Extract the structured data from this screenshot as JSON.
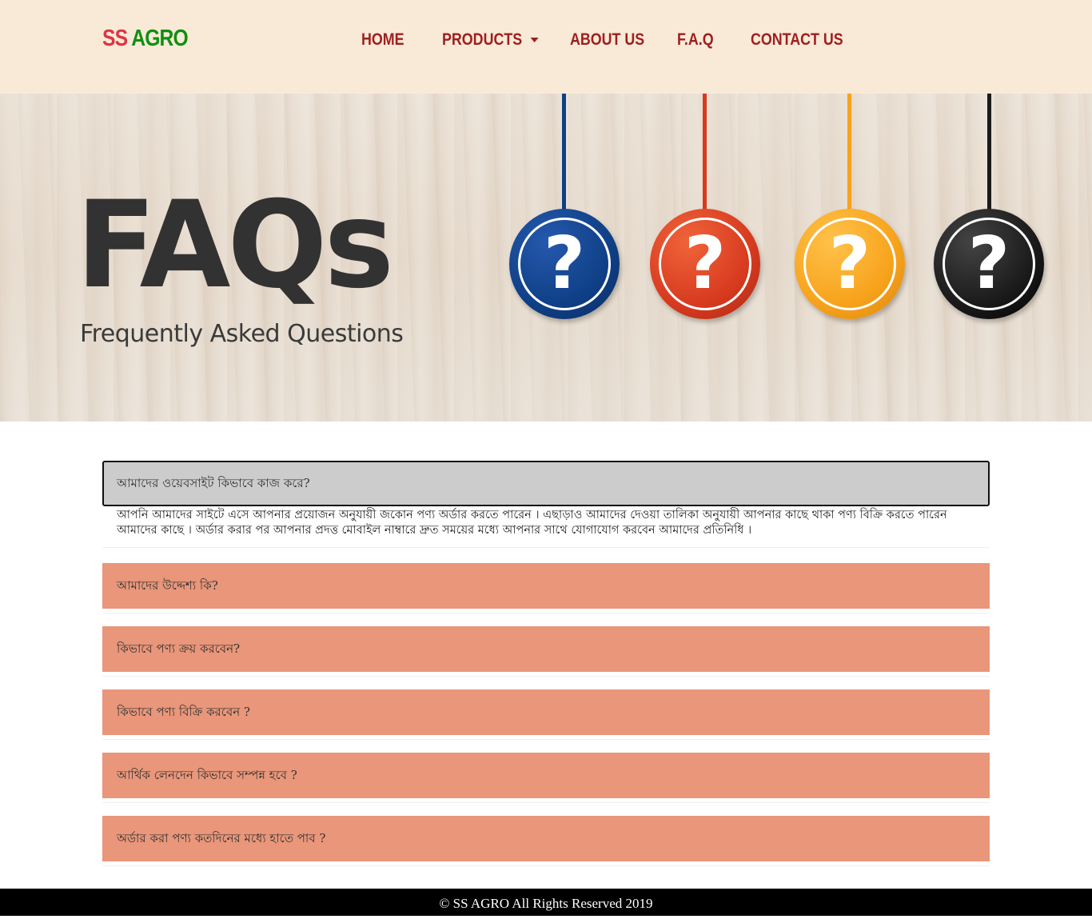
{
  "brand": {
    "part1": "SS",
    "part2": "AGRO"
  },
  "nav": {
    "home": "HOME",
    "products": "PRODUCTS",
    "about": "ABOUT US",
    "faq": "F.A.Q",
    "contact": "CONTACT US"
  },
  "banner": {
    "title": "FAQs",
    "subtitle": "Frequently Asked Questions",
    "mark": "?",
    "ball_colors": [
      "#0f3f86",
      "#d73a1f",
      "#f7a21b",
      "#1a1a1a"
    ]
  },
  "faqs": [
    {
      "question": "আমাদের ওয়েবসাইট কিভাবে কাজ করে?",
      "answer": "আপনি আমাদের সাইটে এসে আপনার প্রয়োজন অনুযায়ী জকোন পণ্য অর্ডার করতে পারেন । এছাড়াও আমাদের দেওয়া তালিকা অনুযায়ী আপনার কাছে থাকা পণ্য বিক্রি করতে পারেন আমাদের কাছে । অর্ডার করার পর আপনার প্রদত্ত মোবাইল নাম্বারে দ্রুত সময়ের মধ্যে আপনার সাথে যোগাযোগ করবেন আমাদের প্রতিনিধি ।",
      "expanded": true
    },
    {
      "question": "আমাদের উদ্দেশ্য কি?",
      "expanded": false
    },
    {
      "question": "কিভাবে পণ্য ক্রয় করবেন?",
      "expanded": false
    },
    {
      "question": "কিভাবে পণ্য বিক্রি করবেন ?",
      "expanded": false
    },
    {
      "question": "আর্থিক লেনদেন কিভাবে সম্পন্ন হবে ?",
      "expanded": false
    },
    {
      "question": "অর্ডার করা পণ্য কতদিনের মধ্যে হাতে পাব ?",
      "expanded": false
    }
  ],
  "footer": {
    "text": "© SS AGRO All Rights Reserved 2019"
  },
  "colors": {
    "navbar_bg": "#f9ead8",
    "nav_link": "#9e1f1f",
    "brand_red": "#dc3545",
    "brand_green": "#109010",
    "faq_header": "#e9967a",
    "faq_header_active": "#cccccc",
    "footer_bg": "#000000"
  }
}
